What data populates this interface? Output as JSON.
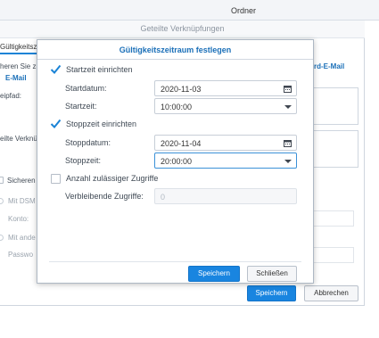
{
  "top_bar": {
    "title": "Ordner"
  },
  "background_window": {
    "title": "Geteilte Verknüpfungen",
    "tab_label": "Gültigkeitszeit",
    "text_lines": [
      "heren Sie zu",
      "E-Mail",
      "eipfad:",
      "eilte Verknü",
      "Sicheren A",
      "Mit DSM",
      "Konto:",
      "Mit ande",
      "Passwo"
    ],
    "link_text": "rd-E-Mail",
    "buttons": {
      "save": "Speichern",
      "cancel": "Abbrechen"
    }
  },
  "modal": {
    "title": "Gültigkeitszeitraum festlegen",
    "start": {
      "checkbox_label": "Startzeit einrichten",
      "checked": true,
      "date_label": "Startdatum:",
      "date_value": "2020-11-03",
      "time_label": "Startzeit:",
      "time_value": "10:00:00"
    },
    "stop": {
      "checkbox_label": "Stoppzeit einrichten",
      "checked": true,
      "date_label": "Stoppdatum:",
      "date_value": "2020-11-04",
      "time_label": "Stoppzeit:",
      "time_value": "20:00:00"
    },
    "access": {
      "checkbox_label": "Anzahl zulässiger Zugriffe",
      "checked": false,
      "remaining_label": "Verbleibende Zugriffe:",
      "remaining_value": "0"
    },
    "buttons": {
      "save": "Speichern",
      "close": "Schließen"
    }
  },
  "icons": {
    "calendar": "calendar-icon",
    "dropdown": "chevron-down-icon",
    "check": "checkmark-icon"
  },
  "colors": {
    "accent": "#1985e0",
    "title_blue": "#1a6fb8",
    "check_blue": "#1a83d6"
  }
}
